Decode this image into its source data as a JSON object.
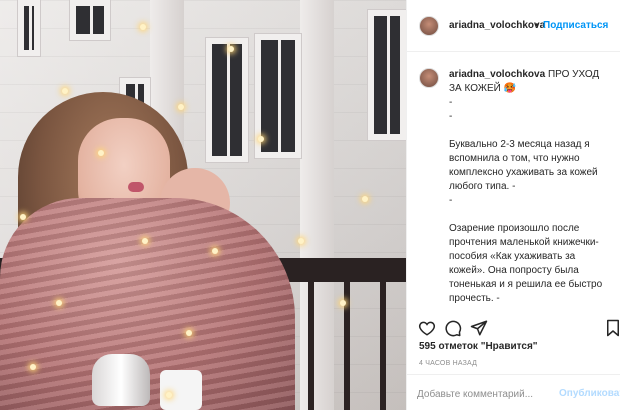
{
  "post": {
    "username": "ariadna_volochkova",
    "follow_label": "Подписаться",
    "dot": "•",
    "caption_user": "ariadna_volochkova",
    "caption_title": "ПРО УХОД ЗА КОЖЕЙ",
    "caption_emoji": "🥵",
    "caption_body": "-\n-\n\nБуквально 2-3 месяца назад я вспомнила о том, что нужно комплексно ухаживать за кожей любого типа. -\n-\n\nОзарение произошло после прочтения маленькой книжечки-пособия «Как ухаживать за кожей». Она попросту была тоненькая и я решила ее быстро прочесть. -\n-\n\nЯ прошла тест и поняла, что у меня комбинированная кожа",
    "likes_text": "595 отметок \"Нравится\"",
    "time_text": "4 ЧАСОВ НАЗАД"
  },
  "comment": {
    "placeholder": "Добавьте комментарий...",
    "post_label": "Опубликовать"
  },
  "icons": {
    "like": "heart-icon",
    "comment": "comment-icon",
    "share": "paper-plane-icon",
    "save": "bookmark-icon"
  },
  "colors": {
    "accent": "#0095f6",
    "post_disabled": "#b3dbff",
    "muted": "#8e8e8e",
    "text": "#262626",
    "divider": "#efefef"
  }
}
